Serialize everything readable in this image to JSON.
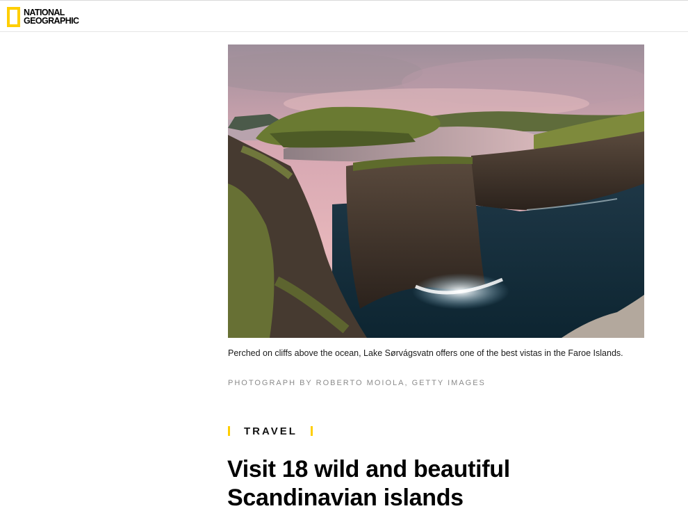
{
  "header": {
    "logo_line1": "NATIONAL",
    "logo_line2": "GEOGRAPHIC",
    "brand_color": "#ffce00"
  },
  "hero": {
    "image_description": "",
    "caption": "Perched on cliffs above the ocean, Lake Sørvágsvatn offers one of the best vistas in the Faroe Islands.",
    "credit": "PHOTOGRAPH BY ROBERTO MOIOLA, GETTY IMAGES"
  },
  "article": {
    "kicker": "TRAVEL",
    "headline": "Visit 18 wild and beautiful Scandinavian islands"
  }
}
